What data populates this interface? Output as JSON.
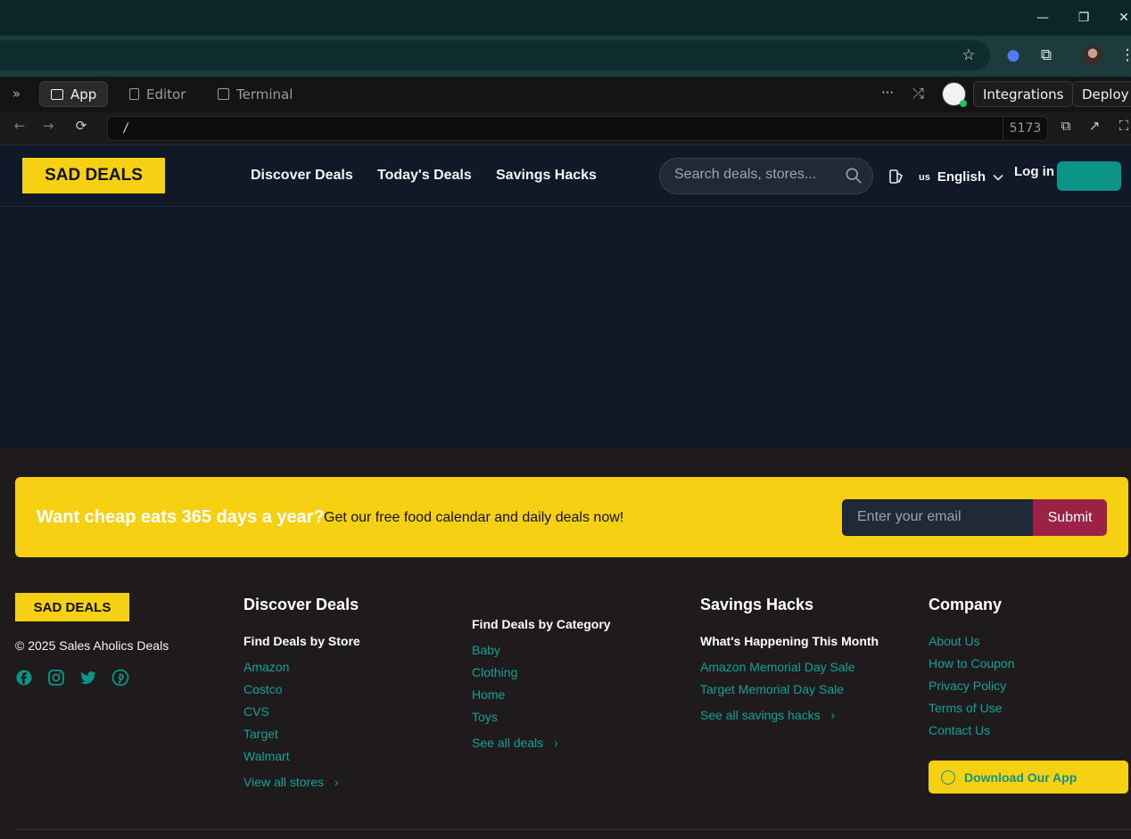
{
  "window": {
    "minimize": "—",
    "restore": "❐",
    "close": "✕"
  },
  "replit": {
    "tabs": [
      {
        "label": "App"
      },
      {
        "label": "Editor"
      },
      {
        "label": "Terminal"
      }
    ],
    "integrations": "Integrations",
    "deploy": "Deploy",
    "more": "···",
    "url_path": "/",
    "port": "5173"
  },
  "site": {
    "logo": "SAD DEALS",
    "nav": [
      "Discover Deals",
      "Today's Deals",
      "Savings Hacks"
    ],
    "search_placeholder": "Search deals, stores...",
    "lang_code": "us",
    "lang_label": "English",
    "login": "Log in"
  },
  "footer": {
    "banner_heading": "Want cheap eats 365 days a year?",
    "banner_sub": "Get our free food calendar and daily deals now!",
    "email_placeholder": "Enter your email",
    "submit": "Submit",
    "logo": "SAD DEALS",
    "copyright": "© 2025 Sales Aholics Deals",
    "discover": {
      "heading": "Discover Deals",
      "store_heading": "Find Deals by Store",
      "stores": [
        "Amazon",
        "Costco",
        "CVS",
        "Target",
        "Walmart"
      ],
      "view_all": "View all stores",
      "category_heading": "Find Deals by Category",
      "categories": [
        "Baby",
        "Clothing",
        "Home",
        "Toys"
      ],
      "see_all": "See all deals"
    },
    "hacks": {
      "heading": "Savings Hacks",
      "sub": "What's Happening This Month",
      "links": [
        "Amazon Memorial Day Sale",
        "Target Memorial Day Sale"
      ],
      "see_all": "See all savings hacks"
    },
    "company": {
      "heading": "Company",
      "links": [
        "About Us",
        "How to Coupon",
        "Privacy Policy",
        "Terms of Use",
        "Contact Us"
      ],
      "app": "Download Our App"
    }
  }
}
